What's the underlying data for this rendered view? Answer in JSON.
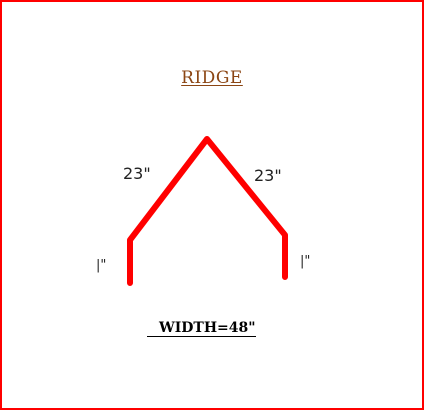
{
  "title": "RIDGE",
  "dimensions": {
    "left_slope": "23\"",
    "right_slope": "23\"",
    "left_leg": "|\"",
    "right_leg": "|\""
  },
  "footer": "WIDTH=48\"",
  "colors": {
    "border": "#ff0000",
    "profile": "#ff0000",
    "title": "#8b4513"
  }
}
